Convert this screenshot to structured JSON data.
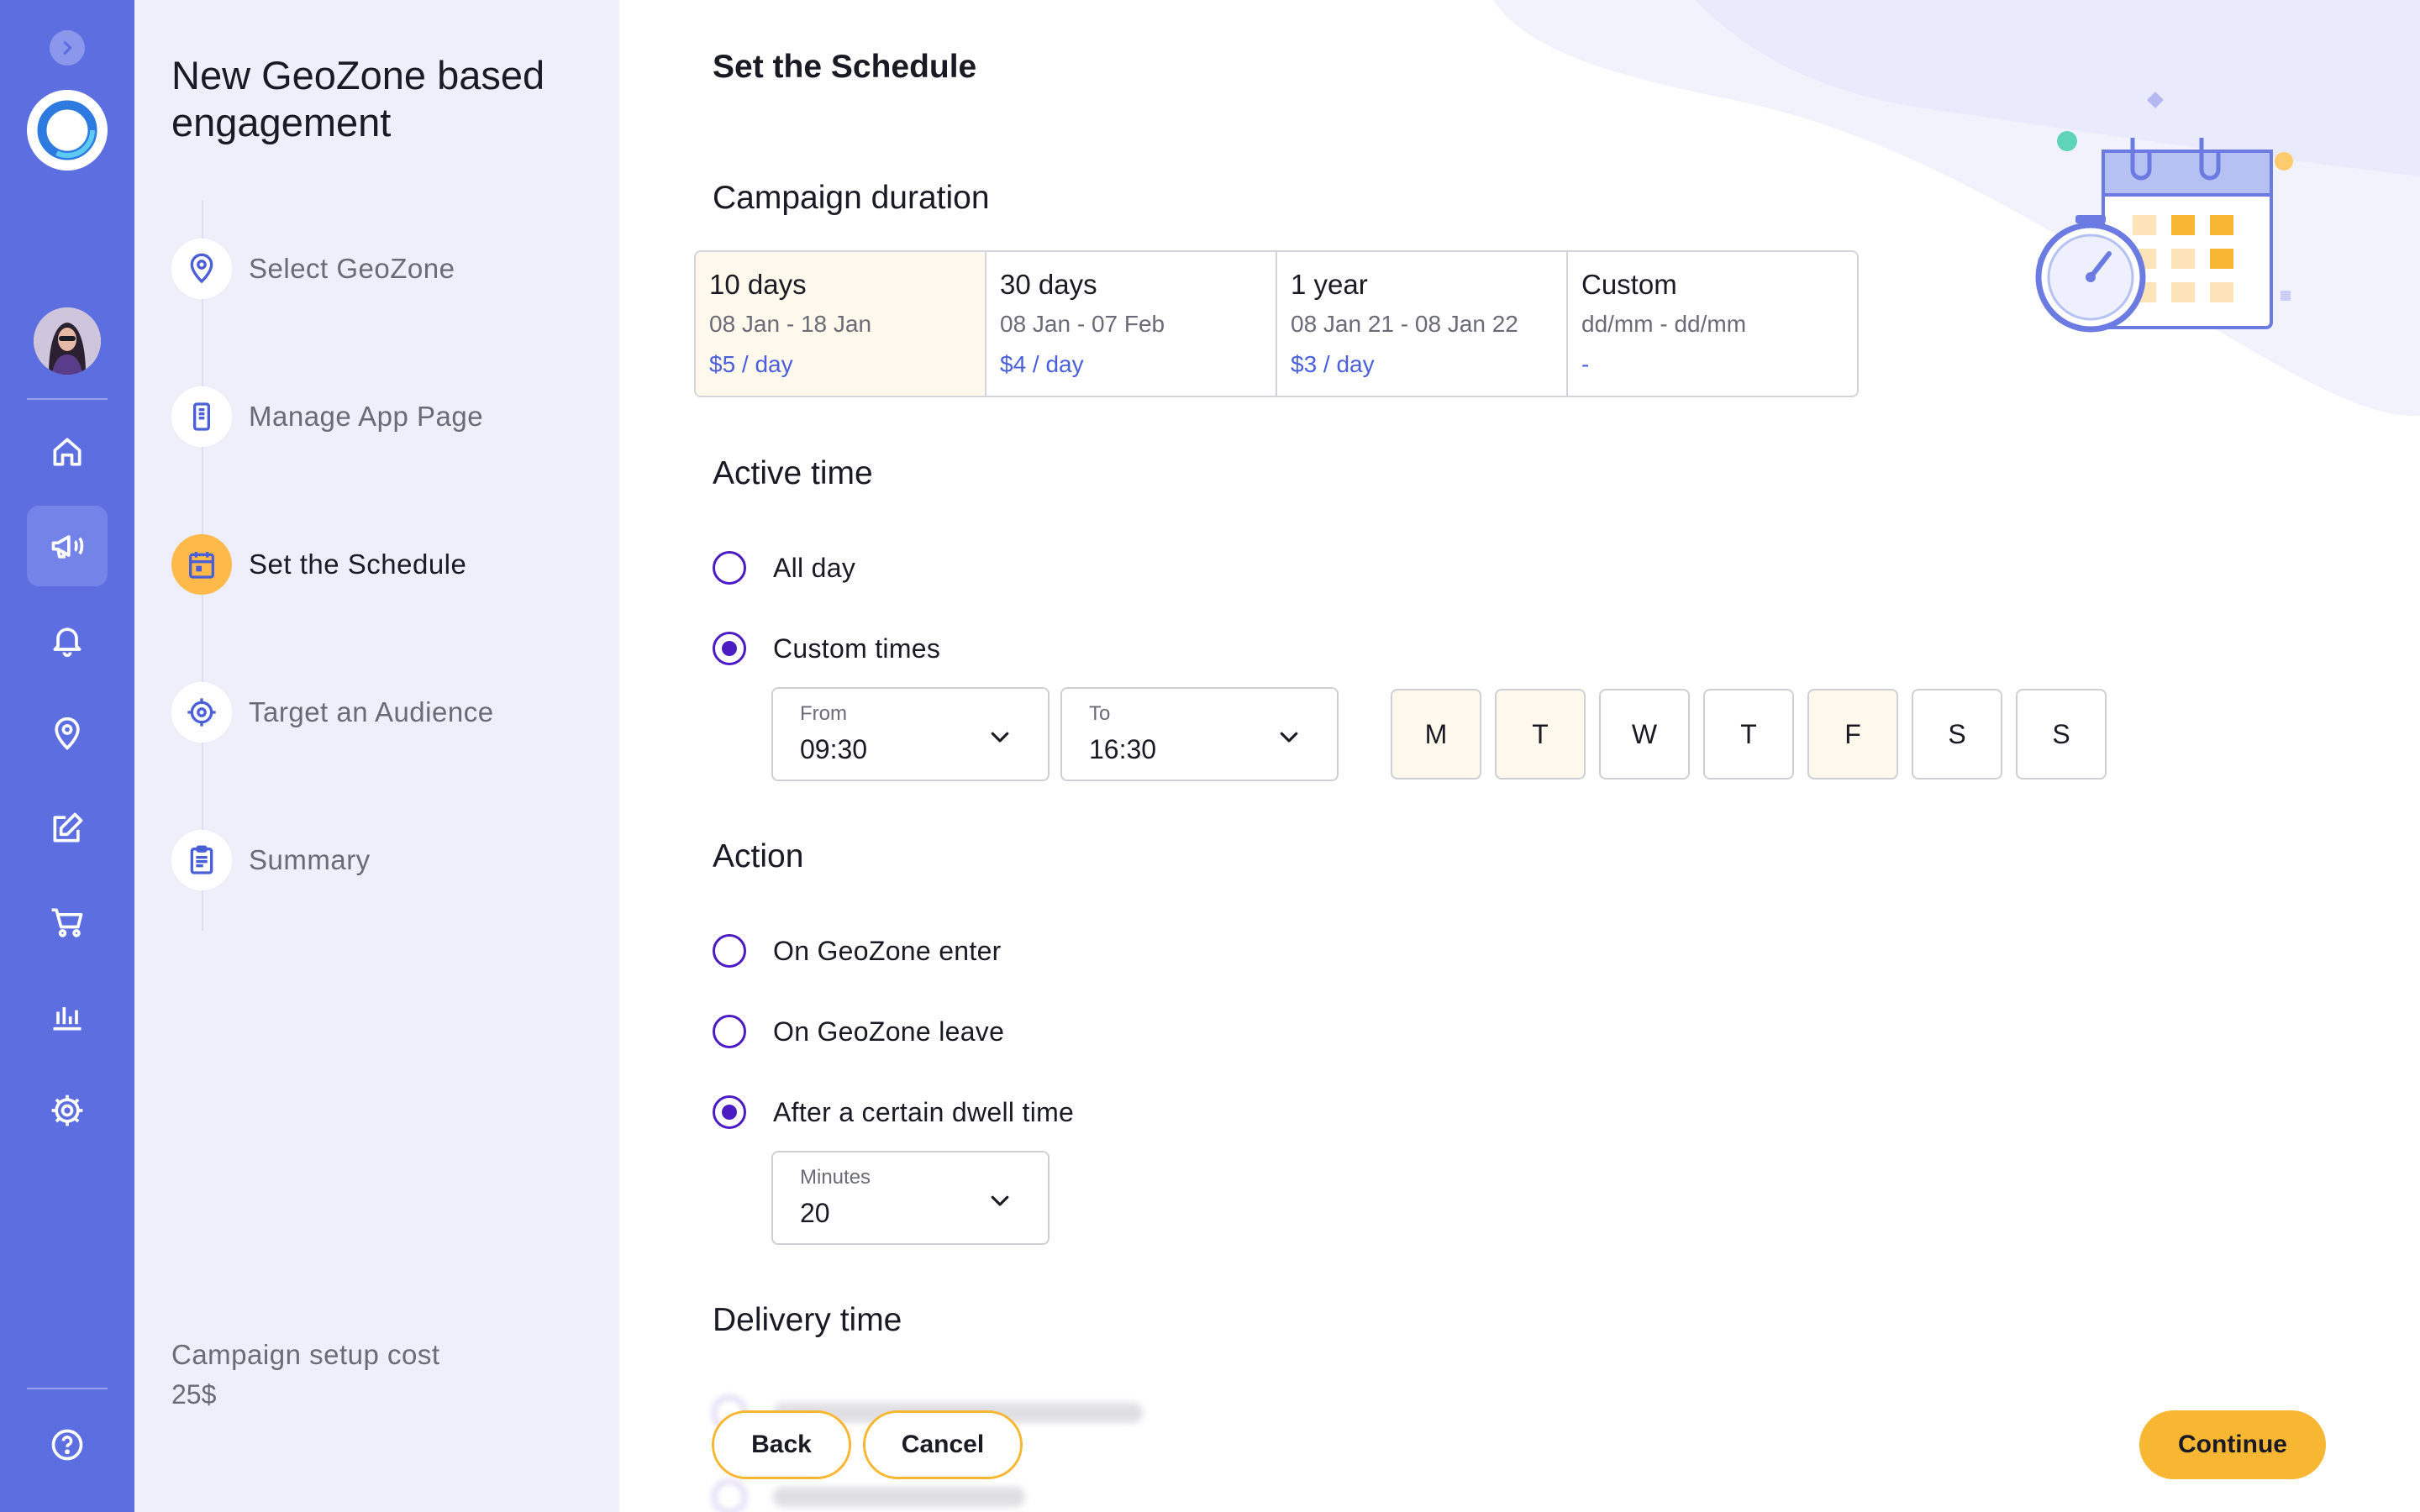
{
  "colors": {
    "rail": "#5d6fe0",
    "accent": "#f7b733",
    "radio": "#4a1cc2",
    "price": "#4a5fd8",
    "selected_bg": "#fff8ec"
  },
  "rail": {
    "icons": [
      "chevron-right-icon",
      "logo",
      "avatar",
      "home-icon",
      "megaphone-icon",
      "bell-icon",
      "location-pin-icon",
      "edit-icon",
      "cart-icon",
      "chart-icon",
      "gear-icon",
      "help-icon"
    ],
    "active": "megaphone-icon"
  },
  "steps": {
    "title": "New GeoZone based engagement",
    "items": [
      {
        "label": "Select GeoZone",
        "icon": "location-pin-icon",
        "state": "done"
      },
      {
        "label": "Manage App Page",
        "icon": "phone-page-icon",
        "state": "done"
      },
      {
        "label": "Set the Schedule",
        "icon": "calendar-icon",
        "state": "active"
      },
      {
        "label": "Target an Audience",
        "icon": "target-icon",
        "state": "pending"
      },
      {
        "label": "Summary",
        "icon": "clipboard-icon",
        "state": "pending"
      }
    ],
    "cost_label": "Campaign setup cost",
    "cost_value": "25$"
  },
  "main": {
    "title": "Set the Schedule",
    "duration": {
      "title": "Campaign duration",
      "options": [
        {
          "name": "10 days",
          "range": "08 Jan - 18 Jan",
          "price": "$5 / day",
          "selected": true
        },
        {
          "name": "30 days",
          "range": "08 Jan - 07 Feb",
          "price": "$4 / day",
          "selected": false
        },
        {
          "name": "1 year",
          "range": "08 Jan 21 - 08 Jan 22",
          "price": "$3 / day",
          "selected": false
        },
        {
          "name": "Custom",
          "range": "dd/mm - dd/mm",
          "price": "-",
          "selected": false
        }
      ]
    },
    "active_time": {
      "title": "Active time",
      "options": [
        {
          "label": "All day",
          "checked": false
        },
        {
          "label": "Custom times",
          "checked": true
        }
      ],
      "from": {
        "label": "From",
        "value": "09:30"
      },
      "to": {
        "label": "To",
        "value": "16:30"
      },
      "days": [
        {
          "label": "M",
          "selected": true
        },
        {
          "label": "T",
          "selected": true
        },
        {
          "label": "W",
          "selected": false
        },
        {
          "label": "T",
          "selected": false
        },
        {
          "label": "F",
          "selected": true
        },
        {
          "label": "S",
          "selected": false
        },
        {
          "label": "S",
          "selected": false
        }
      ]
    },
    "action": {
      "title": "Action",
      "options": [
        {
          "label": "On GeoZone enter",
          "checked": false
        },
        {
          "label": "On GeoZone leave",
          "checked": false
        },
        {
          "label": "After a certain dwell time",
          "checked": true
        }
      ],
      "minutes": {
        "label": "Minutes",
        "value": "20"
      }
    },
    "delivery": {
      "title": "Delivery time"
    },
    "buttons": {
      "back": "Back",
      "cancel": "Cancel",
      "continue": "Continue"
    }
  }
}
